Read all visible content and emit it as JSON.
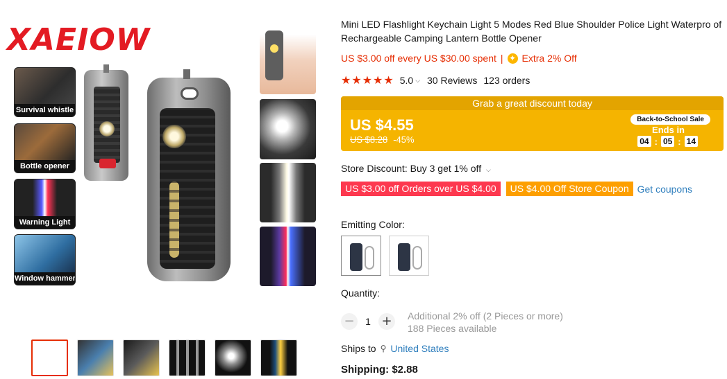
{
  "brand": {
    "logo_text": "XAEIOW"
  },
  "gallery": {
    "features": [
      {
        "label": "Survival whistle"
      },
      {
        "label": "Bottle opener"
      },
      {
        "label": "Warning Light"
      },
      {
        "label": "Window hammer"
      }
    ],
    "thumbnails_count": 6
  },
  "product": {
    "title": "Mini LED Flashlight Keychain Light 5 Modes Red Blue Shoulder Police Light Waterpro of Rechargeable Camping Lantern Bottle Opener",
    "promo_text": "US $3.00 off every US $30.00 spent",
    "promo_sep": "|",
    "extra_off": "Extra 2% Off",
    "rating": {
      "stars": "★★★★★",
      "score": "5.0",
      "reviews": "30 Reviews",
      "orders": "123 orders"
    }
  },
  "deal": {
    "header": "Grab a great discount today",
    "price": "US $4.55",
    "old_price": "US $8.28",
    "discount": "-45%",
    "badge": "Back-to-School Sale",
    "ends_label": "Ends in",
    "timer": {
      "h": "04",
      "m": "05",
      "s": "14"
    }
  },
  "store": {
    "discount_text": "Store Discount: Buy 3 get 1% off",
    "coupon_red": "US $3.00 off Orders over US $4.00",
    "coupon_orange": "US $4.00 Off Store Coupon",
    "get_coupons": "Get coupons"
  },
  "variant": {
    "label": "Emitting Color:"
  },
  "quantity": {
    "label": "Quantity:",
    "minus": "−",
    "plus": "+",
    "value": "1",
    "additional": "Additional 2% off (2 Pieces or more)",
    "available": "188 Pieces available"
  },
  "shipping": {
    "ships_to_label": "Ships to",
    "country": "United States",
    "cost": "Shipping: $2.88"
  },
  "colors": {
    "accent_red": "#e62e04",
    "deal_yellow": "#f5b400",
    "coupon_red": "#fd384f",
    "coupon_orange": "#fd9f00",
    "link_blue": "#2e7ebd"
  },
  "icons": {
    "chevron": "chevron-down-icon",
    "location": "location-pin-icon",
    "coin": "coin-icon"
  }
}
